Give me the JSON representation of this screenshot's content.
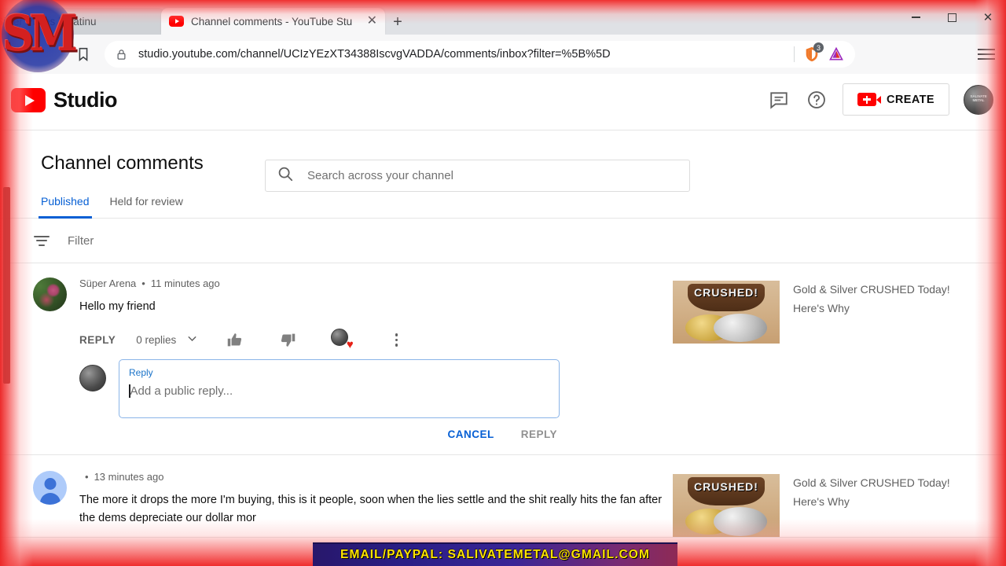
{
  "browser": {
    "tabs": [
      {
        "title": "es | Silver Prices | Platinu",
        "active": false,
        "icon": "generic-page-icon"
      },
      {
        "title": "Channel comments - YouTube Stu",
        "active": true,
        "icon": "youtube-icon"
      }
    ],
    "new_tab_label": "+",
    "close_tab_label": "✕",
    "window_controls": {
      "minimize": "minimize-icon",
      "maximize": "maximize-icon",
      "close": "✕"
    },
    "address_bar": {
      "url": "studio.youtube.com/channel/UCIzYEzXT34388IscvgVADDA/comments/inbox?filter=%5B%5D",
      "lock_icon": "lock-icon",
      "bookmark_icon": "bookmark-icon"
    },
    "extensions": [
      {
        "name": "brave-shields-icon",
        "badge": "3"
      },
      {
        "name": "brave-rewards-triangle-icon",
        "badge": ""
      }
    ],
    "menu_icon": "hamburger-menu-icon"
  },
  "studio": {
    "logo_text": "Studio",
    "search": {
      "placeholder": "Search across your channel",
      "icon": "search-icon"
    },
    "header_actions": {
      "comments_icon": "comments-icon",
      "help_icon": "help-circle-icon",
      "create_label": "CREATE",
      "create_icon": "video-camera-plus-icon",
      "avatar": "SALIVATE METAL"
    },
    "page_title": "Channel comments",
    "tabs": [
      {
        "label": "Published",
        "selected": true
      },
      {
        "label": "Held for review",
        "selected": false
      }
    ],
    "filter": {
      "placeholder": "Filter",
      "icon": "filter-icon"
    },
    "comments": [
      {
        "author": "Süper Arena",
        "separator": "•",
        "timestamp": "11 minutes ago",
        "text": "Hello my friend",
        "avatar_type": "photo",
        "actions": {
          "reply_label": "REPLY",
          "replies_count_label": "0 replies",
          "expand_icon": "chevron-down-icon",
          "like_icon": "thumbs-up-icon",
          "dislike_icon": "thumbs-down-icon",
          "heart_icon": "heart-icon",
          "more_icon": "kebab-menu-icon"
        },
        "composer": {
          "label": "Reply",
          "placeholder": "Add a public reply...",
          "cancel_label": "CANCEL",
          "submit_label": "REPLY"
        },
        "video": {
          "title": "Gold & Silver CRUSHED Today!  Here's Why",
          "thumbnail_text": "CRUSHED!"
        }
      },
      {
        "author": "",
        "separator": "•",
        "timestamp": "13 minutes ago",
        "text": "The more it drops the more I'm buying, this is it people, soon when the lies settle and the shit really hits the fan after the dems depreciate our dollar mor",
        "avatar_type": "default",
        "video": {
          "title": "Gold & Silver CRUSHED Today!  Here's Why",
          "thumbnail_text": "CRUSHED!"
        }
      }
    ]
  },
  "overlay": {
    "banner_text": "EMAIL/PAYPAL: SALIVATEMETAL@GMAIL.COM",
    "watermark_text": "SM"
  },
  "colors": {
    "accent_blue": "#065fd4",
    "youtube_red": "#ff0000",
    "heart_red": "#e62117",
    "banner_yellow": "#ffe400",
    "frame_red": "#ec2a2a"
  }
}
